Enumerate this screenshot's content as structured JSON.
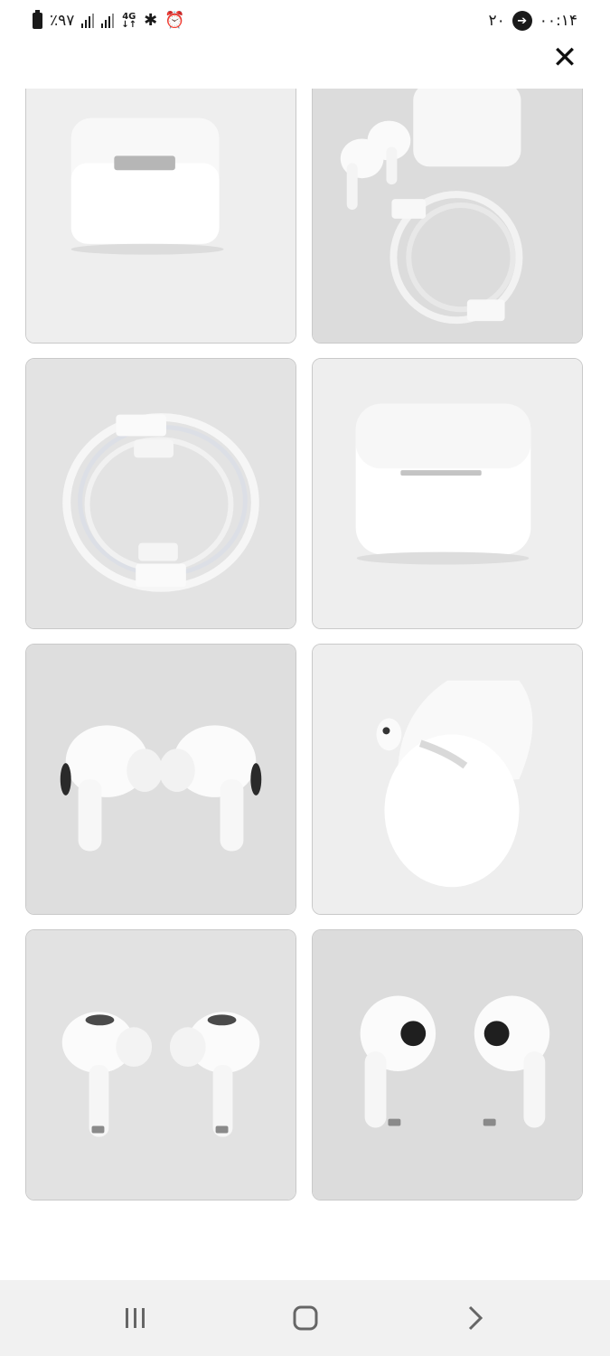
{
  "status_bar": {
    "battery": "٪۹۷",
    "network": "4G",
    "time": "۰۰:۱۴",
    "notification_count": "۲۰"
  },
  "gallery": {
    "images": [
      {
        "subject": "airpods-case-closed-front"
      },
      {
        "subject": "airpods-with-case-and-cable"
      },
      {
        "subject": "coiled-charging-cable"
      },
      {
        "subject": "airpods-case-closed-angle"
      },
      {
        "subject": "earbuds-pair-side"
      },
      {
        "subject": "case-open-with-earbud"
      },
      {
        "subject": "earbuds-pair-front"
      },
      {
        "subject": "earbuds-pair-rounded"
      }
    ]
  },
  "colors": {
    "background": "#ffffff",
    "navbar": "#f1f1f1",
    "tile_bg": "#e4e4e4"
  },
  "icons": {
    "close": "close-icon",
    "recent_apps": "recent-apps-icon",
    "home": "home-icon",
    "back": "back-icon"
  }
}
